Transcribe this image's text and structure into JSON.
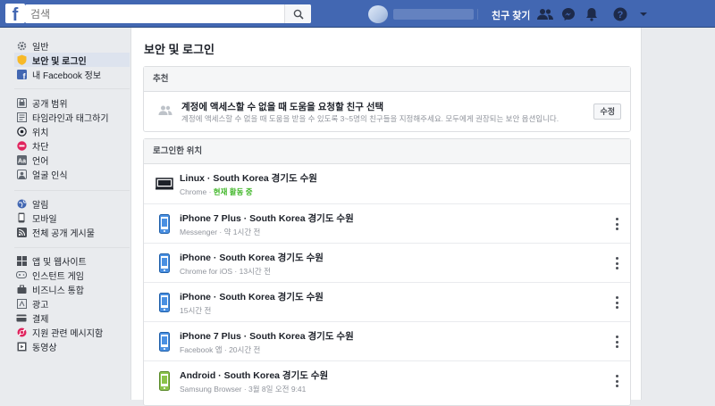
{
  "topbar": {
    "logo": "f",
    "search_placeholder": "검색",
    "find_friends": "친구 찾기",
    "icons": [
      "search-icon",
      "friend-requests-icon",
      "messenger-icon",
      "notifications-icon",
      "help-icon",
      "account-menu-chevron-icon"
    ]
  },
  "sidebar": {
    "group1": [
      {
        "label": "일반",
        "icon": "gear-icon"
      },
      {
        "label": "보안 및 로그인",
        "icon": "shield-icon",
        "active": true
      },
      {
        "label": "내 Facebook 정보",
        "icon": "facebook-icon"
      }
    ],
    "group2": [
      {
        "label": "공개 범위",
        "icon": "privacy-icon"
      },
      {
        "label": "타임라인과 태그하기",
        "icon": "timeline-icon"
      },
      {
        "label": "위치",
        "icon": "location-icon"
      },
      {
        "label": "차단",
        "icon": "block-icon"
      },
      {
        "label": "언어",
        "icon": "language-icon"
      },
      {
        "label": "얼굴 인식",
        "icon": "face-recognition-icon"
      }
    ],
    "group3": [
      {
        "label": "알림",
        "icon": "globe-icon"
      },
      {
        "label": "모바일",
        "icon": "mobile-icon"
      },
      {
        "label": "전체 공개 게시물",
        "icon": "rss-icon"
      }
    ],
    "group4": [
      {
        "label": "앱 및 웹사이트",
        "icon": "apps-icon"
      },
      {
        "label": "인스턴트 게임",
        "icon": "games-icon"
      },
      {
        "label": "비즈니스 통합",
        "icon": "business-icon"
      },
      {
        "label": "광고",
        "icon": "ads-icon"
      },
      {
        "label": "결제",
        "icon": "payments-icon"
      },
      {
        "label": "지원 관련 메시지함",
        "icon": "support-inbox-icon"
      },
      {
        "label": "동영상",
        "icon": "video-icon"
      }
    ]
  },
  "main": {
    "title": "보안 및 로그인",
    "recommended": {
      "header": "추천",
      "title": "계정에 액세스할 수 없을 때 도움을 요청할 친구 선택",
      "description": "계정에 액세스할 수 없을 때 도움을 받을 수 있도록 3~5명의 친구들을 지정해주세요. 모두에게 권장되는 보안 옵션입니다.",
      "edit_label": "수정"
    },
    "logins": {
      "header": "로그인한 위치",
      "items": [
        {
          "title": "Linux · South Korea 경기도 수원",
          "app": "Chrome",
          "sep": " · ",
          "time": "현재 활동 중",
          "active_now": true,
          "device": "desktop-icon",
          "has_more": false
        },
        {
          "title": "iPhone 7 Plus · South Korea 경기도 수원",
          "app": "Messenger",
          "sep": " · ",
          "time": "약 1시간 전",
          "device": "iphone-icon",
          "has_more": true
        },
        {
          "title": "iPhone · South Korea 경기도 수원",
          "app": "Chrome for iOS",
          "sep": " · ",
          "time": "13시간 전",
          "device": "iphone-icon",
          "has_more": true
        },
        {
          "title": "iPhone · South Korea 경기도 수원",
          "app": "",
          "sep": "",
          "time": "15시간 전",
          "device": "iphone-icon",
          "has_more": true
        },
        {
          "title": "iPhone 7 Plus · South Korea 경기도 수원",
          "app": "Facebook 앱",
          "sep": " · ",
          "time": "20시간 전",
          "device": "iphone-icon",
          "has_more": true
        },
        {
          "title": "Android · South Korea 경기도 수원",
          "app": "Samsung Browser",
          "sep": " · ",
          "time": "3월 8일 오전 9:41",
          "device": "android-icon",
          "has_more": true
        }
      ]
    }
  },
  "colors": {
    "brand": "#4267b2",
    "active_green": "#42b72a",
    "iphone_blue": "#4a90e2",
    "android_green": "#8bc34a"
  }
}
